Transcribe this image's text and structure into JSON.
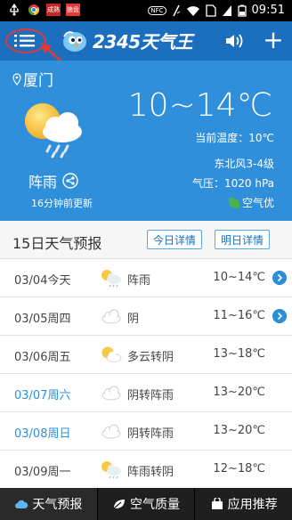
{
  "status_bar": {
    "app1_label": "成熟",
    "app2_label": "狼盘",
    "nfc_label": "NFC",
    "time": "09:51"
  },
  "header": {
    "logo_text": "2345天气王",
    "add_label": "+"
  },
  "weather": {
    "city": "厦门",
    "condition": "阵雨",
    "updated": "16分钟前更新",
    "temp_range": "10~14℃",
    "current_temp": "当前温度：10℃",
    "wind": "东北风3-4级",
    "pressure": "气压：1020 hPa",
    "aqi": "空气优"
  },
  "forecast": {
    "title": "15日天气预报",
    "today_button": "今日详情",
    "tomorrow_button": "明日详情",
    "rows": [
      {
        "date": "03/04今天",
        "icon": "sun-rain-icon",
        "cond": "阵雨",
        "temp": "10~14℃",
        "weekend": false,
        "chevron": true
      },
      {
        "date": "03/05周四",
        "icon": "cloud-icon",
        "cond": "阴",
        "temp": "11~16℃",
        "weekend": false,
        "chevron": true
      },
      {
        "date": "03/06周五",
        "icon": "sun-cloud-icon",
        "cond": "多云转阴",
        "temp": "13~18℃",
        "weekend": false,
        "chevron": false
      },
      {
        "date": "03/07周六",
        "icon": "cloud-icon",
        "cond": "阴转阵雨",
        "temp": "13~20℃",
        "weekend": true,
        "chevron": false
      },
      {
        "date": "03/08周日",
        "icon": "cloud-icon",
        "cond": "阴转阵雨",
        "temp": "13~20℃",
        "weekend": true,
        "chevron": false
      },
      {
        "date": "03/09周一",
        "icon": "sun-rain-icon",
        "cond": "阵雨转阴",
        "temp": "12~18℃",
        "weekend": false,
        "chevron": false
      }
    ]
  },
  "tabs": [
    {
      "label": "天气预报",
      "icon": "cloud-icon",
      "active": true
    },
    {
      "label": "空气质量",
      "icon": "leaf-icon",
      "active": false
    },
    {
      "label": "应用推荐",
      "icon": "bag-icon",
      "active": false
    }
  ],
  "colors": {
    "header_blue": "#1b6fbe",
    "panel_blue": "#2f8fdb",
    "weekend_blue": "#2b8fd9",
    "annotation_red": "#e53935"
  }
}
